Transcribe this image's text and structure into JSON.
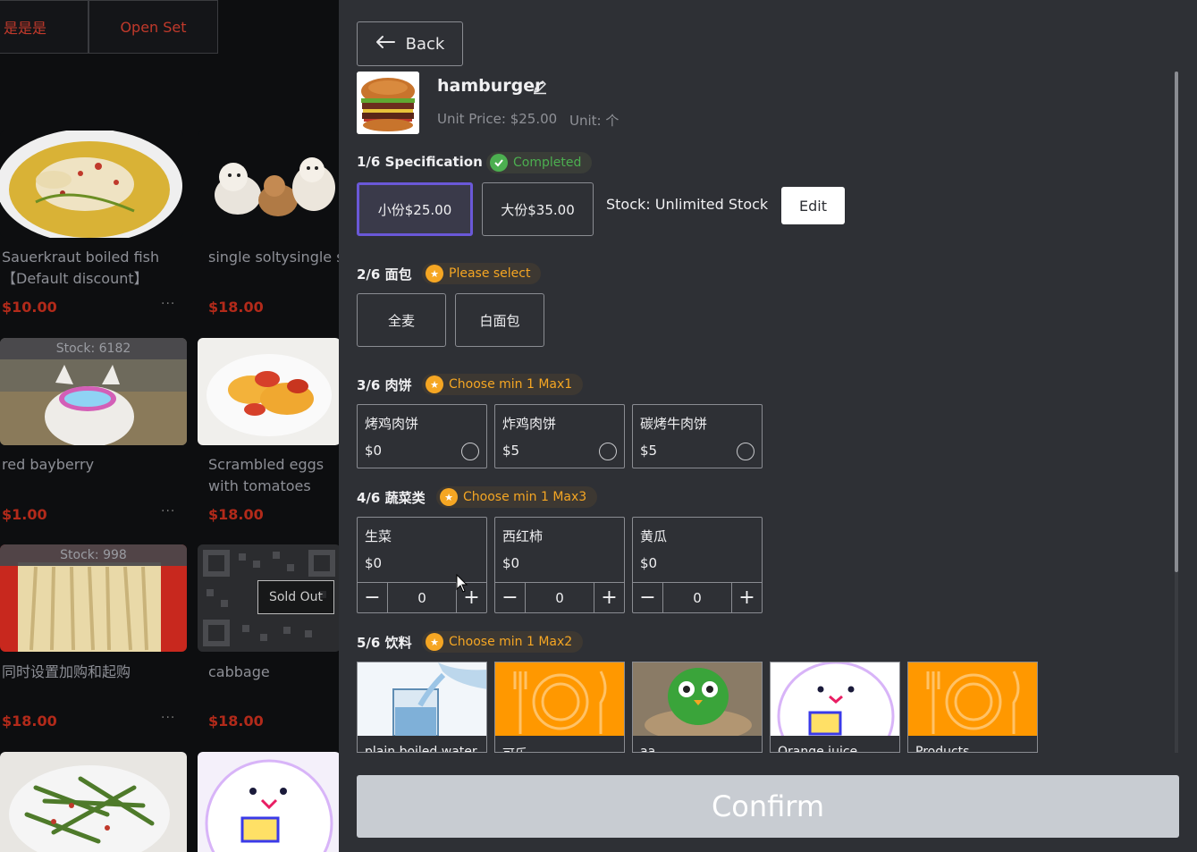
{
  "left_menu": {
    "tabs": [
      "是是是",
      "Open Set"
    ],
    "items": [
      {
        "name": "Sauerkraut boiled fish 【Default discount】",
        "price": "$10.00",
        "dots": "···"
      },
      {
        "name": "single soltysingle soltysingle soltyaba",
        "price": "$18.00"
      },
      {
        "name": "red bayberry",
        "price": "$1.00",
        "stock": "Stock: 6182",
        "dots": "···"
      },
      {
        "name": "Scrambled eggs with tomatoes",
        "price": "$18.00"
      },
      {
        "name": "同时设置加购和起购",
        "price": "$18.00",
        "stock": "Stock: 998",
        "dots": "···"
      },
      {
        "name": "cabbage",
        "price": "$18.00",
        "sold_out": "Sold Out"
      }
    ]
  },
  "panel": {
    "back_label": "Back",
    "product": {
      "name": "hamburger",
      "unit_price": "Unit Price: $25.00",
      "unit": "Unit: 个"
    },
    "spec": {
      "title": "1/6 Specification",
      "badge": "Completed",
      "options": [
        {
          "label": "小份$25.00",
          "selected": true
        },
        {
          "label": "大份$35.00",
          "selected": false
        }
      ],
      "stock": "Stock: Unlimited Stock",
      "edit_label": "Edit"
    },
    "bread": {
      "title": "2/6 面包",
      "badge": "Please select",
      "options": [
        "全麦",
        "白面包"
      ]
    },
    "patty": {
      "title": "3/6 肉饼",
      "badge": "Choose min 1 Max1",
      "items": [
        {
          "name": "烤鸡肉饼",
          "price": "$0"
        },
        {
          "name": "炸鸡肉饼",
          "price": "$5"
        },
        {
          "name": "碳烤牛肉饼",
          "price": "$5"
        }
      ]
    },
    "veg": {
      "title": "4/6 蔬菜类",
      "badge": "Choose min 1 Max3",
      "items": [
        {
          "name": "生菜",
          "price": "$0",
          "qty": "0"
        },
        {
          "name": "西红柿",
          "price": "$0",
          "qty": "0"
        },
        {
          "name": "黄瓜",
          "price": "$0",
          "qty": "0"
        }
      ]
    },
    "drinks": {
      "title": "5/6 饮料",
      "badge": "Choose min 1 Max2",
      "items": [
        {
          "name": "plain boiled water"
        },
        {
          "name": "可乐"
        },
        {
          "name": "aa"
        },
        {
          "name": "Orange juice"
        },
        {
          "name": "Products"
        }
      ]
    },
    "confirm_label": "Confirm"
  },
  "colors": {
    "accent_selected": "#6a58d8",
    "completed": "#4caf50",
    "warning": "#f5a623",
    "price_red": "#b22a1a"
  }
}
